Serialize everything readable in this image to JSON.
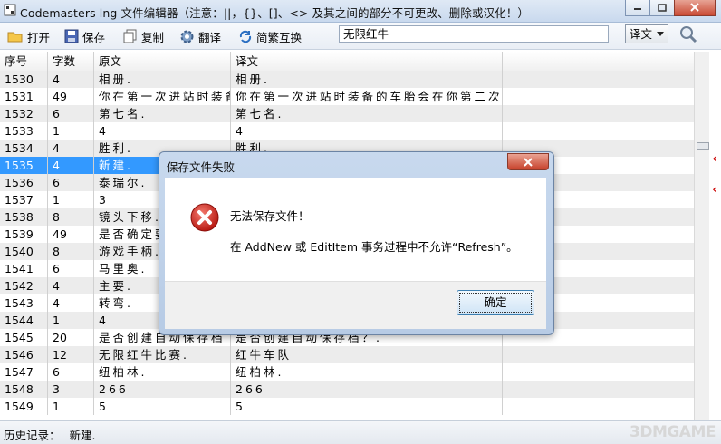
{
  "window": {
    "title": "Codemasters lng 文件编辑器（注意：||，{}、[]、<> 及其之间的部分不可更改、删除或汉化！）"
  },
  "toolbar": {
    "open_label": "打开",
    "save_label": "保存",
    "copy_label": "复制",
    "translate_label": "翻译",
    "convert_label": "简繁互换",
    "search_value": "无限红牛",
    "lang_select": "译文"
  },
  "table": {
    "headers": [
      "序号",
      "字数",
      "原文",
      "译文"
    ],
    "rows": [
      [
        "1530",
        "4",
        "相册.",
        "相册."
      ],
      [
        "1531",
        "49",
        "你在第一次进站时装备",
        "你在第一次进站时装备的车胎会在你第二次"
      ],
      [
        "1532",
        "6",
        "第七名.",
        "第七名."
      ],
      [
        "1533",
        "1",
        "4",
        "4"
      ],
      [
        "1534",
        "4",
        "胜利.",
        "胜利."
      ],
      [
        "1535",
        "4",
        "新建.",
        ""
      ],
      [
        "1536",
        "6",
        "泰瑞尔.",
        ""
      ],
      [
        "1537",
        "1",
        "3",
        ""
      ],
      [
        "1538",
        "8",
        "镜头下移.",
        ""
      ],
      [
        "1539",
        "49",
        "是否确定要",
        ""
      ],
      [
        "1540",
        "8",
        "游戏手柄.",
        ""
      ],
      [
        "1541",
        "6",
        "马里奥.",
        ""
      ],
      [
        "1542",
        "4",
        "主要.",
        ""
      ],
      [
        "1543",
        "4",
        "转弯.",
        ""
      ],
      [
        "1544",
        "1",
        "4",
        ""
      ],
      [
        "1545",
        "20",
        "是否创建自动保存档",
        "是否创建自动保存档？."
      ],
      [
        "1546",
        "12",
        "无限红牛比赛.",
        "红牛车队"
      ],
      [
        "1547",
        "6",
        "纽柏林.",
        "纽柏林."
      ],
      [
        "1548",
        "3",
        "266",
        "266"
      ],
      [
        "1549",
        "1",
        "5",
        "5"
      ]
    ]
  },
  "status": {
    "history_label": "历史记录：",
    "history_value": "新建.",
    "watermark": "3DMGAME"
  },
  "dialog": {
    "title": "保存文件失败",
    "message1": "无法保存文件！",
    "message2": "在 AddNew 或 EditItem 事务过程中不允许“Refresh”。",
    "ok_label": "确定"
  },
  "colors": {
    "selection": "#3399ff",
    "title_gradient": "#c9d9ee",
    "error_red": "#cc1e1e"
  }
}
